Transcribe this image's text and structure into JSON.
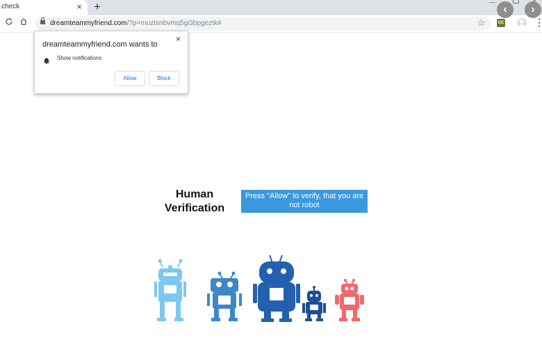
{
  "browser": {
    "tab_title": "check",
    "tab_close": "×",
    "new_tab": "+",
    "url_domain": "dreamteammyfriend.com",
    "url_path": "/?p=muztsnbvmq5gi3bpgeztk#",
    "extension_badge": "GC"
  },
  "popup": {
    "title": "dreamteammyfriend.com wants to",
    "permission": "Show notifications",
    "close": "×",
    "allow_label": "Allow",
    "block_label": "Block"
  },
  "page": {
    "heading_line1": "Human",
    "heading_line2": "Verification",
    "verify_line1": "Press \"Allow\" to verify, that you are",
    "verify_line2": "not robot"
  },
  "colors": {
    "accent_blue": "#3a98de",
    "robot_light_blue": "#7cc8ee",
    "robot_mid_blue": "#3d87c8",
    "robot_dark_blue": "#2360ad",
    "robot_navy": "#1f4e94",
    "robot_red": "#ee6a6e"
  },
  "icons": [
    "back-icon",
    "reload-icon",
    "home-icon",
    "lock-icon",
    "star-icon",
    "menu-icon",
    "bell-icon",
    "close-icon"
  ]
}
